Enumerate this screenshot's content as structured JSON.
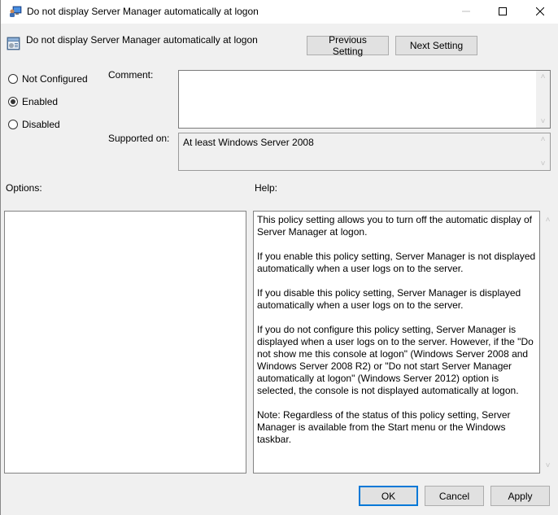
{
  "window": {
    "title": "Do not display Server Manager automatically at logon",
    "controls": {
      "minimize": "minimize",
      "maximize": "maximize",
      "close": "close"
    }
  },
  "header": {
    "setting_title": "Do not display Server Manager automatically at logon",
    "previous_label": "Previous Setting",
    "next_label": "Next Setting"
  },
  "state": {
    "options": [
      {
        "label": "Not Configured",
        "checked": false
      },
      {
        "label": "Enabled",
        "checked": true
      },
      {
        "label": "Disabled",
        "checked": false
      }
    ]
  },
  "comment": {
    "label": "Comment:",
    "value": ""
  },
  "supported": {
    "label": "Supported on:",
    "value": "At least Windows Server 2008"
  },
  "options_section": {
    "label": "Options:"
  },
  "help_section": {
    "label": "Help:",
    "paragraphs": [
      "This policy setting allows you to turn off the automatic display of Server Manager at logon.",
      "If you enable this policy setting, Server Manager is not displayed automatically when a user logs on to the server.",
      "If you disable this policy setting, Server Manager is displayed automatically when a user logs on to the server.",
      "If you do not configure this policy setting, Server Manager is displayed when a user logs on to the server. However, if the \"Do not show me this console at logon\" (Windows Server 2008 and Windows Server 2008 R2) or \"Do not start Server Manager automatically at logon\" (Windows Server 2012) option is selected, the console is not displayed automatically at logon.",
      "Note: Regardless of the status of this policy setting, Server Manager is available from the Start menu or the Windows taskbar."
    ]
  },
  "footer": {
    "ok_label": "OK",
    "cancel_label": "Cancel",
    "apply_label": "Apply"
  },
  "colors": {
    "accent": "#0078d7",
    "background": "#f0f0f0",
    "button": "#e1e1e1"
  }
}
